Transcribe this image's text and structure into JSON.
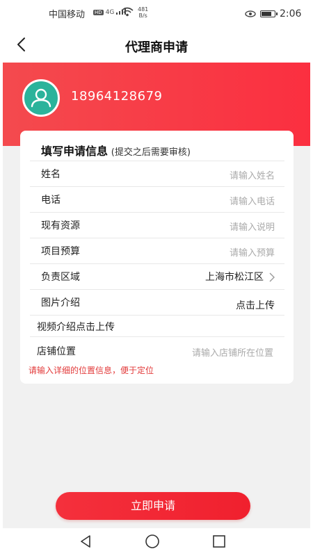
{
  "status": {
    "carrier": "中国移动",
    "hd": "HD",
    "network": "4G",
    "speed_value": "481",
    "speed_unit": "B/s",
    "time": "2:06",
    "battery_level": 0.7
  },
  "nav": {
    "title": "代理商申请"
  },
  "user": {
    "phone": "18964128679"
  },
  "form": {
    "title": "填写申请信息",
    "title_note": "(提交之后需要审核)",
    "fields": [
      {
        "label": "姓名",
        "placeholder": "请输入姓名"
      },
      {
        "label": "电话",
        "placeholder": "请输入电话"
      },
      {
        "label": "现有资源",
        "placeholder": "请输入说明"
      },
      {
        "label": "项目预算",
        "placeholder": "请输入预算"
      },
      {
        "label": "负责区域",
        "value": "上海市松江区"
      },
      {
        "label": "图片介绍",
        "value": "点击上传"
      },
      {
        "label": "视频介绍",
        "inline_value": "点击上传"
      },
      {
        "label": "店铺位置",
        "placeholder": "请输入店铺所在位置"
      }
    ],
    "hint": "请输入详细的位置信息，便于定位"
  },
  "submit_label": "立即申请",
  "colors": {
    "brand_red": "#f4303c",
    "avatar_teal": "#2bb39b",
    "hint_red": "#e23a3a"
  }
}
